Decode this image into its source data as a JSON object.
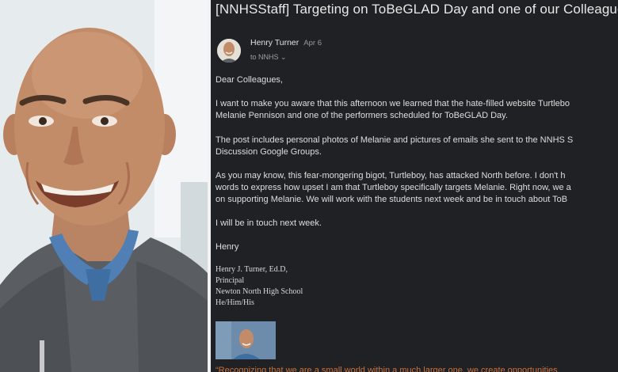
{
  "email": {
    "subject": "[NNHSStaff] Targeting on ToBeGLAD Day and one of our Colleagues",
    "sender_name": "Henry Turner",
    "date": "Apr 6",
    "to_line": "to NNHS",
    "to_chevron": "⌄",
    "greeting": "Dear Colleagues,",
    "paragraph1_line1": "I want to make you aware that this afternoon we learned that the hate-filled website Turtlebo",
    "paragraph1_line2": "Melanie Pennison and one of the performers scheduled for ToBeGLAD Day.",
    "paragraph2_line1": "The post includes personal photos of Melanie and pictures of emails she sent to the NNHS S",
    "paragraph2_line2": "Discussion Google Groups.",
    "paragraph3_line1": "As you may know, this fear-mongering bigot, Turtleboy, has attacked North before.  I don't h",
    "paragraph3_line2": "words to express how upset I am that Turtleboy specifically targets Melanie.  Right now, we a",
    "paragraph3_line3": "on supporting Melanie.  We will work with the students next week and be in touch about ToB",
    "paragraph4": "I will be in touch next week.",
    "signoff": "Henry",
    "signature": {
      "name": "Henry J. Turner, Ed.D,",
      "title": "Principal",
      "school": "Newton North High School",
      "pronouns": "He/Him/His"
    },
    "quote_fragment": "“Recognizing that we are a small world within a much larger one, we create opportunities"
  }
}
